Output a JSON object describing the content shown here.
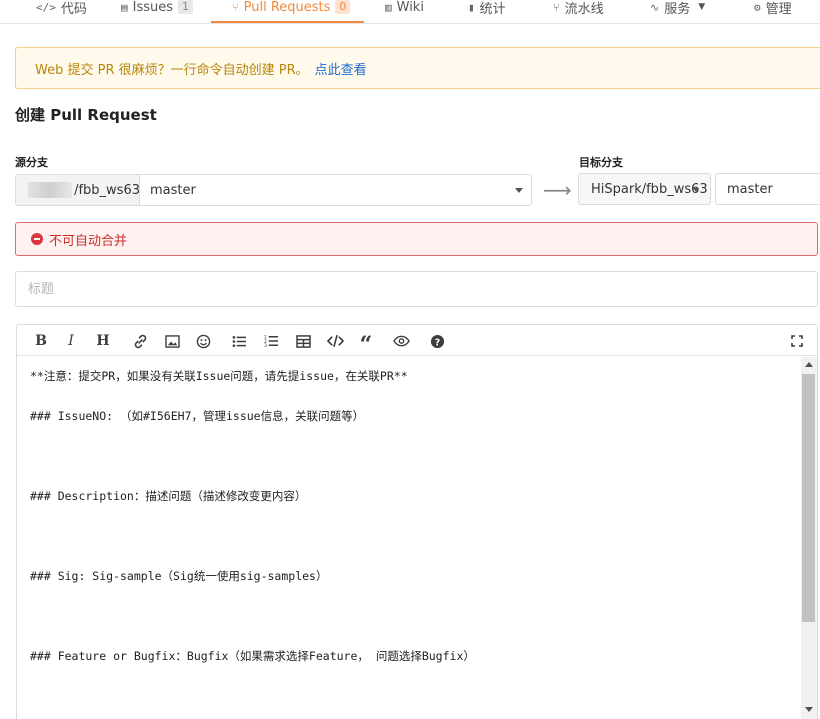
{
  "nav": {
    "tabs": [
      {
        "icon": "code-icon",
        "label": "代码"
      },
      {
        "icon": "issues-icon",
        "label": "Issues",
        "count": "1"
      },
      {
        "icon": "pull-request-icon",
        "label": "Pull Requests",
        "count": "0",
        "active": true
      },
      {
        "icon": "wiki-icon",
        "label": "Wiki"
      },
      {
        "icon": "stats-icon",
        "label": "统计"
      },
      {
        "icon": "pipeline-icon",
        "label": "流水线"
      },
      {
        "icon": "service-icon",
        "label": "服务"
      },
      {
        "icon": "manage-icon",
        "label": "管理"
      }
    ],
    "active_color": "#f08a3d"
  },
  "banner": {
    "text": "Web 提交 PR 很麻烦？一行命令自动创建 PR。",
    "link": "点此查看"
  },
  "page": {
    "title": "创建 Pull Request"
  },
  "source": {
    "label": "源分支",
    "repo": "/fbb_ws63",
    "branch": "master"
  },
  "target": {
    "label": "目标分支",
    "repo": "HiSpark/fbb_ws63",
    "branch": "master"
  },
  "merge_status": {
    "text": "不可自动合并",
    "color": "#c9302c"
  },
  "title_field": {
    "placeholder": "标题",
    "value": ""
  },
  "editor": {
    "toolbar": [
      "bold-icon",
      "italic-icon",
      "heading-icon",
      "link-icon",
      "image-icon",
      "emoji-icon",
      "bulleted-list-icon",
      "numbered-list-icon",
      "table-icon",
      "code-icon",
      "quote-icon",
      "preview-icon",
      "help-icon",
      "fullscreen-icon"
    ],
    "lines": [
      "**注意：提交PR，如果没有关联Issue问题，请先提issue，在关联PR**",
      "",
      "### IssueNO: （如#I56EH7，管理issue信息，关联问题等）",
      "",
      "",
      "",
      "### Description：描述问题（描述修改变更内容）",
      "",
      "",
      "",
      "### Sig: Sig-sample（Sig统一使用sig-samples）",
      "",
      "",
      "",
      "### Feature or Bugfix：Bugfix（如果需求选择Feature， 问题选择Bugfix）"
    ]
  }
}
